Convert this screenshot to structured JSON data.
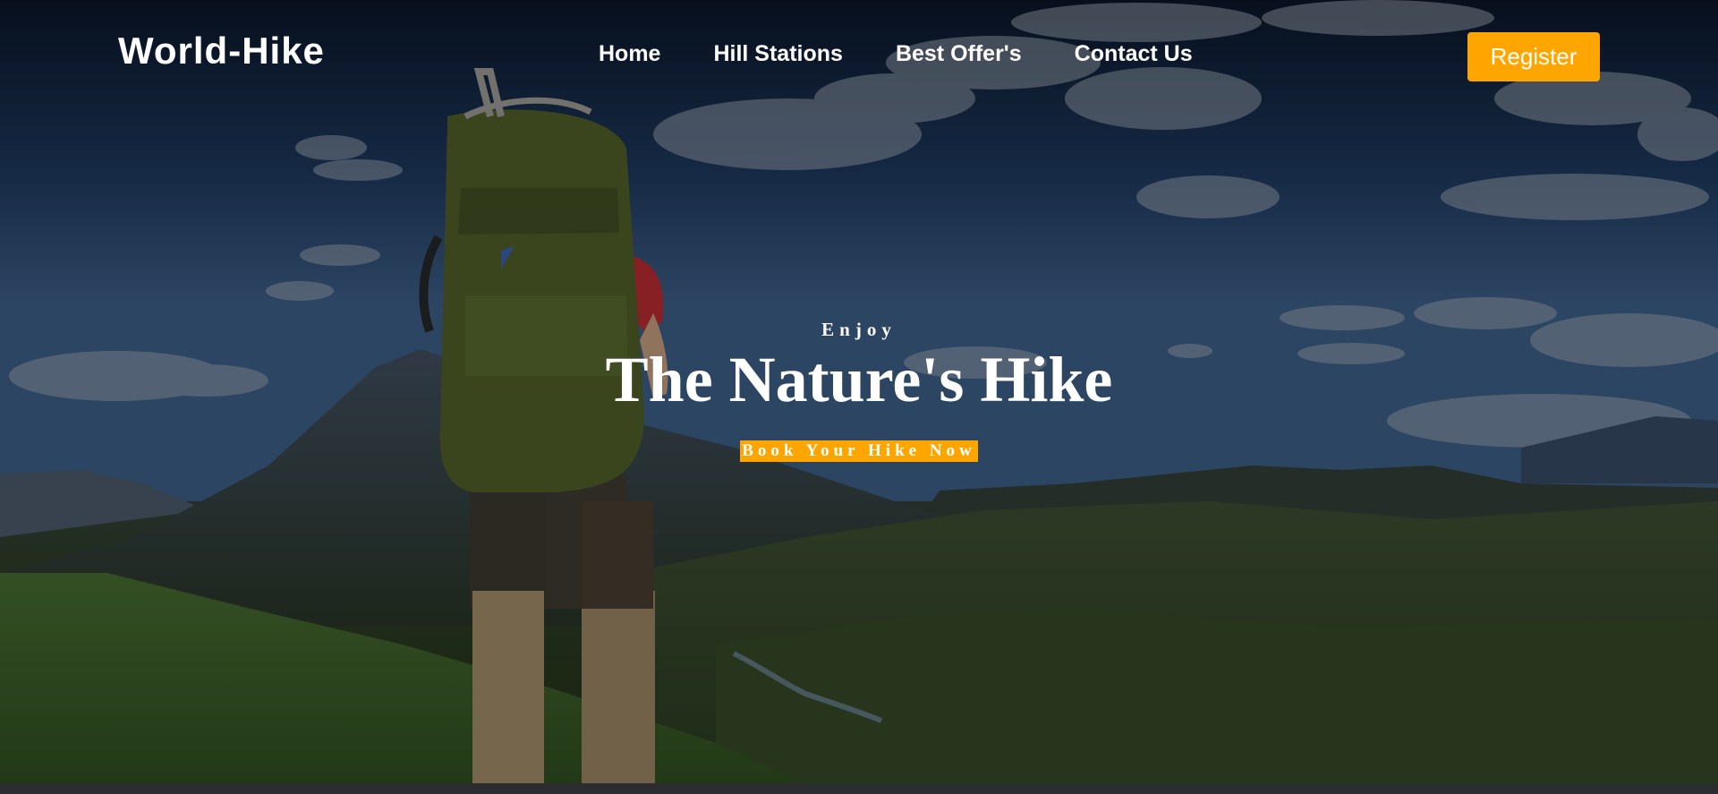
{
  "header": {
    "logo": "World-Hike",
    "nav": [
      {
        "label": "Home"
      },
      {
        "label": "Hill Stations"
      },
      {
        "label": "Best Offer's"
      },
      {
        "label": "Contact Us"
      }
    ],
    "register_label": "Register"
  },
  "hero": {
    "kicker": "Enjoy",
    "title": "The Nature's Hike",
    "cta_label": "Book Your Hike Now",
    "background_image": "hiker-with-backpack-overlooking-mountain-valley"
  },
  "colors": {
    "accent": "#ffa500",
    "text": "#ffffff"
  }
}
